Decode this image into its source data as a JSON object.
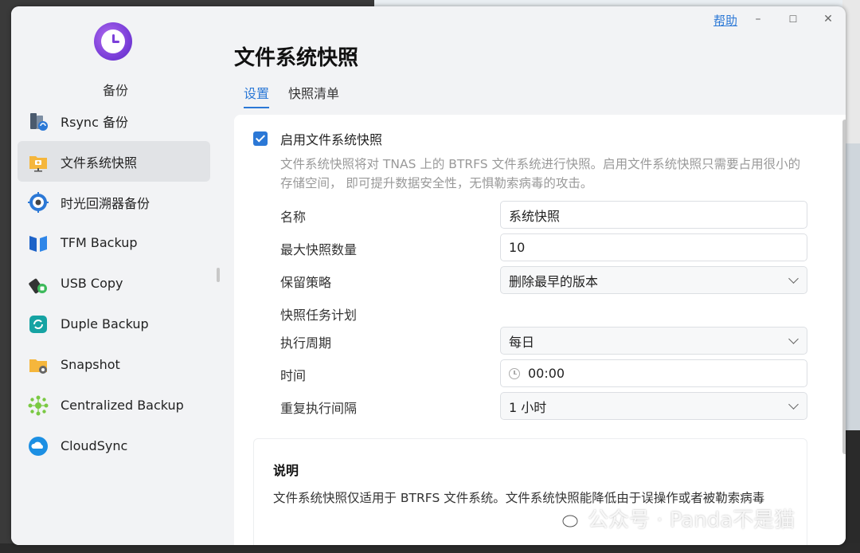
{
  "window": {
    "help_label": "帮助",
    "minimize_symbol": "–",
    "maximize_symbol": "☐",
    "close_symbol": "✕"
  },
  "sidebar": {
    "app_name": "备份",
    "items": [
      {
        "label": "Rsync 备份",
        "icon": "rsync-icon"
      },
      {
        "label": "文件系统快照",
        "icon": "fs-snapshot-icon"
      },
      {
        "label": "时光回溯器备份",
        "icon": "time-machine-icon"
      },
      {
        "label": "TFM Backup",
        "icon": "tfm-icon"
      },
      {
        "label": "USB Copy",
        "icon": "usb-icon"
      },
      {
        "label": "Duple Backup",
        "icon": "duple-icon"
      },
      {
        "label": "Snapshot",
        "icon": "snapshot-folder-icon"
      },
      {
        "label": "Centralized Backup",
        "icon": "centralized-icon"
      },
      {
        "label": "CloudSync",
        "icon": "cloudsync-icon"
      }
    ]
  },
  "main": {
    "title": "文件系统快照",
    "tabs": [
      {
        "label": "设置"
      },
      {
        "label": "快照清单"
      }
    ],
    "enable_label": "启用文件系统快照",
    "description": "文件系统快照将对 TNAS 上的 BTRFS 文件系统进行快照。启用文件系统快照只需要占用很小的存储空间， 即可提升数据安全性，无惧勒索病毒的攻击。",
    "form": {
      "name_label": "名称",
      "name_value": "系统快照",
      "max_label": "最大快照数量",
      "max_value": "10",
      "policy_label": "保留策略",
      "policy_value": "删除最早的版本",
      "schedule_heading": "快照任务计划",
      "period_label": "执行周期",
      "period_value": "每日",
      "time_label": "时间",
      "time_value": "00:00",
      "interval_label": "重复执行间隔",
      "interval_value": "1 小时"
    },
    "note": {
      "title": "说明",
      "text": "文件系统快照仅适用于 BTRFS 文件系统。文件系统快照能降低由于误操作或者被勒索病毒"
    }
  },
  "watermark": "公众号 · Panda不是猫"
}
